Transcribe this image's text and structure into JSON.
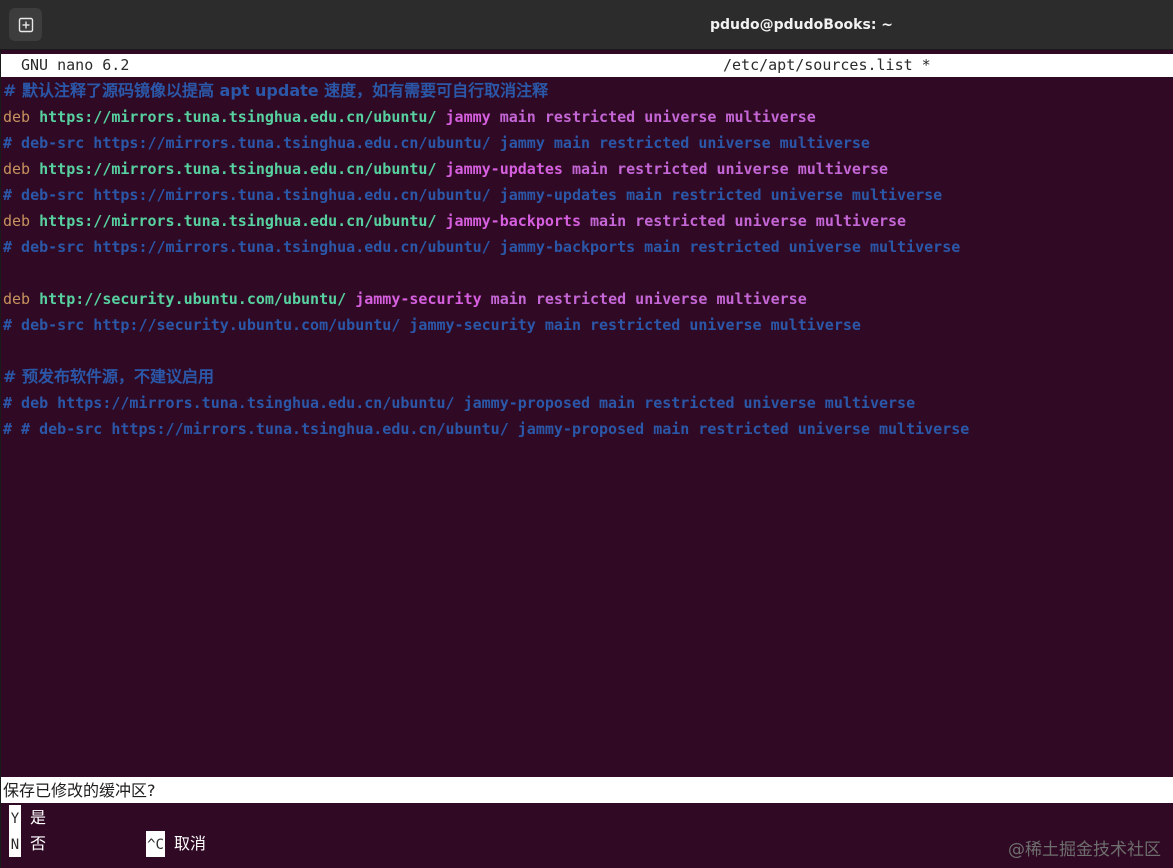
{
  "window": {
    "title": "pdudo@pdudoBooks: ~",
    "new_tab_icon": "new-tab-plus-icon"
  },
  "nano": {
    "version": "GNU nano 6.2",
    "file": "/etc/apt/sources.list *"
  },
  "lines": [
    {
      "type": "zh_comment",
      "text": "# 默认注释了源码镜像以提高 apt update 速度，如有需要可自行取消注释"
    },
    {
      "type": "deb",
      "kw": "deb",
      "url": "https://mirrors.tuna.tsinghua.edu.cn/ubuntu/",
      "dist": "jammy",
      "comps": "main restricted universe multiverse"
    },
    {
      "type": "comment",
      "text": "# deb-src https://mirrors.tuna.tsinghua.edu.cn/ubuntu/ jammy main restricted universe multiverse"
    },
    {
      "type": "deb",
      "kw": "deb",
      "url": "https://mirrors.tuna.tsinghua.edu.cn/ubuntu/",
      "dist": "jammy-updates",
      "comps": "main restricted universe multiverse"
    },
    {
      "type": "comment",
      "text": "# deb-src https://mirrors.tuna.tsinghua.edu.cn/ubuntu/ jammy-updates main restricted universe multiverse"
    },
    {
      "type": "deb",
      "kw": "deb",
      "url": "https://mirrors.tuna.tsinghua.edu.cn/ubuntu/",
      "dist": "jammy-backports",
      "comps": "main restricted universe multiverse"
    },
    {
      "type": "comment",
      "text": "# deb-src https://mirrors.tuna.tsinghua.edu.cn/ubuntu/ jammy-backports main restricted universe multiverse"
    },
    {
      "type": "blank",
      "text": ""
    },
    {
      "type": "deb",
      "kw": "deb",
      "url": "http://security.ubuntu.com/ubuntu/",
      "dist": "jammy-security",
      "comps": "main restricted universe multiverse"
    },
    {
      "type": "comment",
      "text": "# deb-src http://security.ubuntu.com/ubuntu/ jammy-security main restricted universe multiverse"
    },
    {
      "type": "blank",
      "text": ""
    },
    {
      "type": "zh_comment",
      "text": "# 预发布软件源，不建议启用"
    },
    {
      "type": "comment",
      "text": "# deb https://mirrors.tuna.tsinghua.edu.cn/ubuntu/ jammy-proposed main restricted universe multiverse"
    },
    {
      "type": "comment",
      "text": "# # deb-src https://mirrors.tuna.tsinghua.edu.cn/ubuntu/ jammy-proposed main restricted universe multiverse"
    }
  ],
  "prompt": {
    "question": "保存已修改的缓冲区?",
    "options": [
      {
        "key": "Y",
        "label": "是"
      },
      {
        "key": "N",
        "label": "否"
      },
      {
        "key": "^C",
        "label": "取消"
      }
    ]
  },
  "watermark": "@稀土掘金技术社区",
  "colors": {
    "background": "#300a24",
    "comment": "#2b57a8",
    "keyword": "#c7925e",
    "url": "#57d1a0",
    "dist": "#d55fde"
  }
}
